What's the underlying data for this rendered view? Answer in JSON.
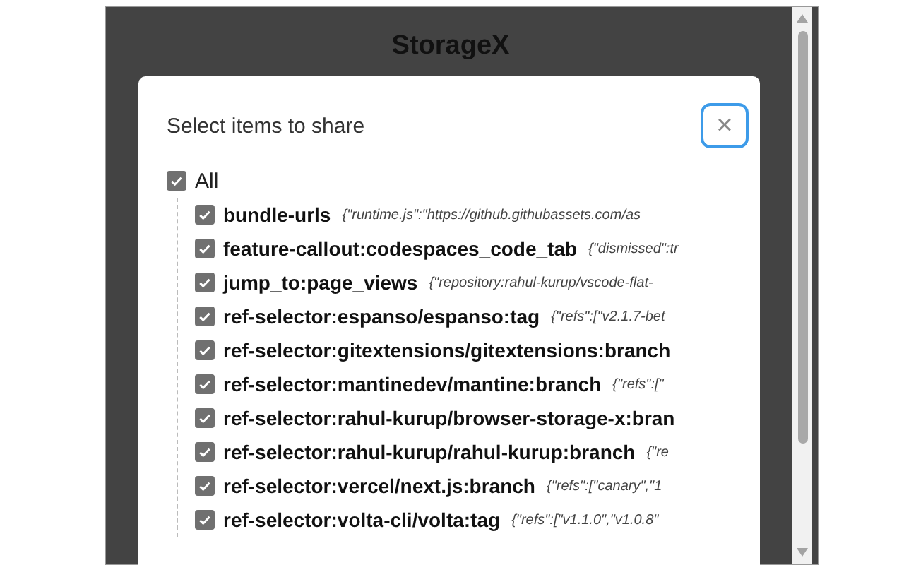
{
  "app": {
    "title": "StorageX"
  },
  "dialog": {
    "title": "Select items to share",
    "close": "×",
    "all": {
      "label": "All",
      "checked": true
    },
    "items": [
      {
        "key": "bundle-urls",
        "value": "{\"runtime.js\":\"https://github.githubassets.com/as",
        "checked": true
      },
      {
        "key": "feature-callout:codespaces_code_tab",
        "value": "{\"dismissed\":tr",
        "checked": true
      },
      {
        "key": "jump_to:page_views",
        "value": "{\"repository:rahul-kurup/vscode-flat-",
        "checked": true
      },
      {
        "key": "ref-selector:espanso/espanso:tag",
        "value": "{\"refs\":[\"v2.1.7-bet",
        "checked": true
      },
      {
        "key": "ref-selector:gitextensions/gitextensions:branch",
        "checked": true
      },
      {
        "key": "ref-selector:mantinedev/mantine:branch",
        "value": "{\"refs\":[\"",
        "checked": true
      },
      {
        "key": "ref-selector:rahul-kurup/browser-storage-x:bran",
        "checked": true
      },
      {
        "key": "ref-selector:rahul-kurup/rahul-kurup:branch",
        "value": "{\"re",
        "checked": true
      },
      {
        "key": "ref-selector:vercel/next.js:branch",
        "value": "{\"refs\":[\"canary\",\"1",
        "checked": true
      },
      {
        "key": "ref-selector:volta-cli/volta:tag",
        "value": "{\"refs\":[\"v1.1.0\",\"v1.0.8\"",
        "checked": true
      }
    ]
  }
}
